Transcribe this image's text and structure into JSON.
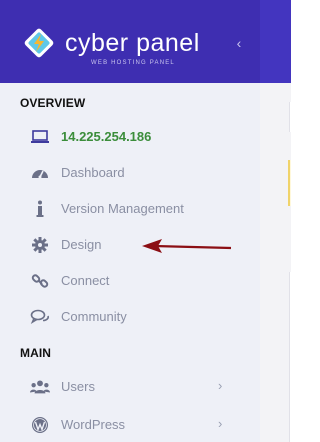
{
  "brand": {
    "name": "cyber panel",
    "subtitle": "WEB HOSTING PANEL"
  },
  "colors": {
    "brand_bg": "#3e2eb1",
    "sidebar_bg": "#eef0f7",
    "ip_text": "#3b8d3b",
    "annotation_arrow": "#8b0e14"
  },
  "sections": {
    "overview": "OVERVIEW",
    "main": "MAIN"
  },
  "nav": {
    "ip": {
      "label": "14.225.254.186",
      "icon": "laptop-icon"
    },
    "dashboard": {
      "label": "Dashboard",
      "icon": "speedometer-icon"
    },
    "version": {
      "label": "Version Management",
      "icon": "info-icon"
    },
    "design": {
      "label": "Design",
      "icon": "gear-icon"
    },
    "connect": {
      "label": "Connect",
      "icon": "link-icon"
    },
    "community": {
      "label": "Community",
      "icon": "chat-bubbles-icon"
    },
    "users": {
      "label": "Users",
      "icon": "users-icon",
      "chevron": "›"
    },
    "wordpress": {
      "label": "WordPress",
      "icon": "wordpress-icon",
      "chevron": "›"
    }
  },
  "collapse_icon": "‹"
}
